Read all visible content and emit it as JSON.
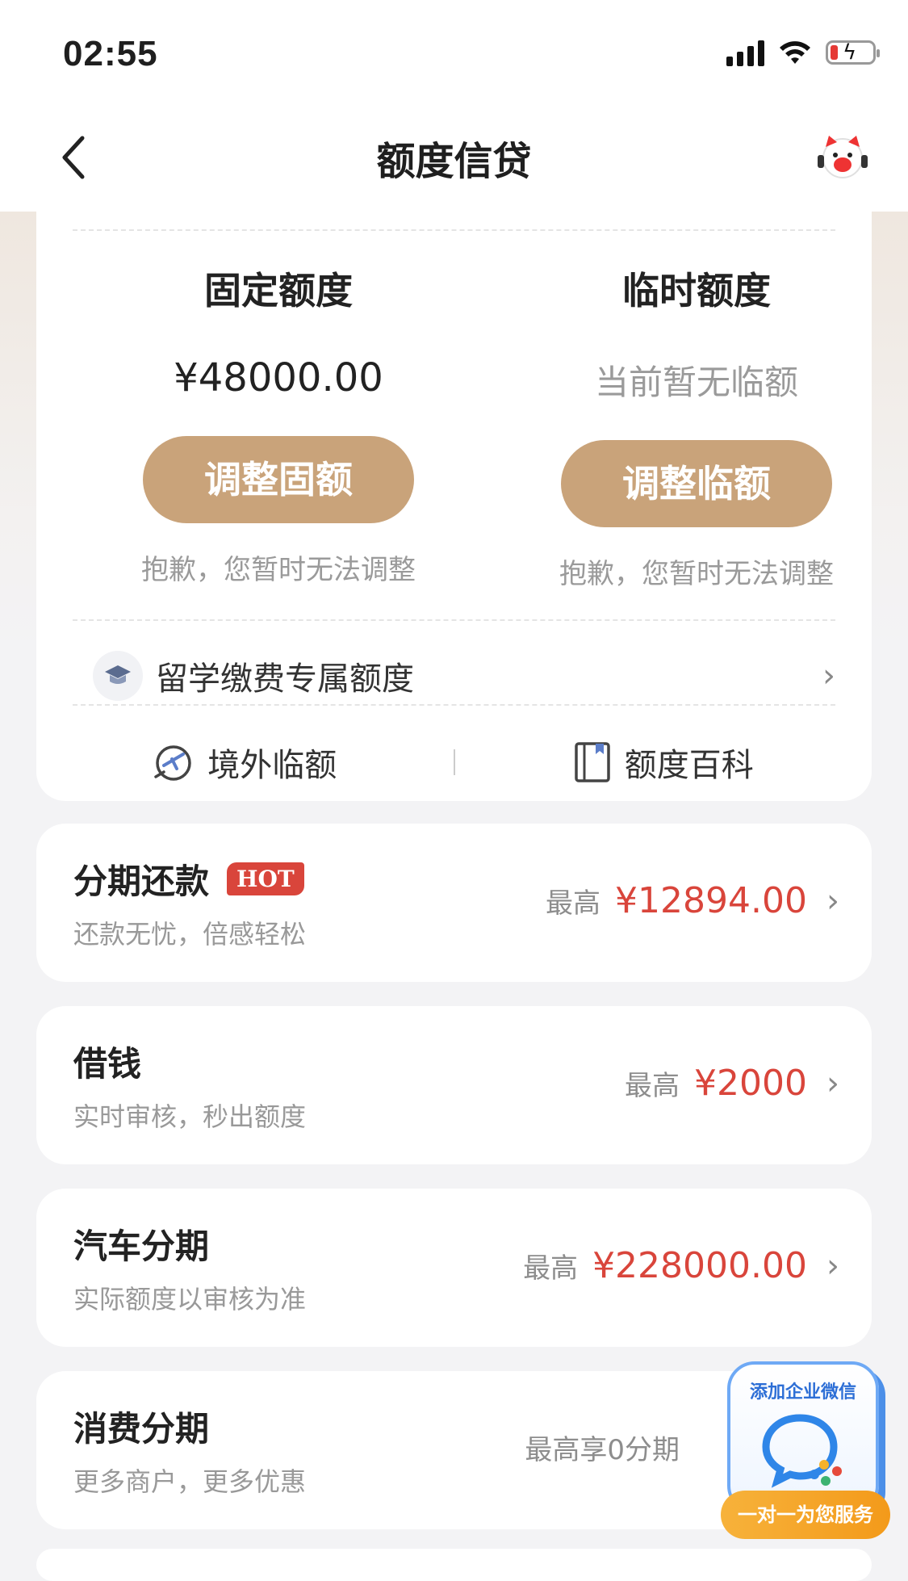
{
  "status": {
    "time": "02:55",
    "battery_percent": 15
  },
  "nav": {
    "title": "额度信贷"
  },
  "limits": {
    "fixed": {
      "title": "固定额度",
      "amount": "¥48000.00",
      "button": "调整固额",
      "hint": "抱歉，您暂时无法调整"
    },
    "temp": {
      "title": "临时额度",
      "amount": "当前暂无临额",
      "button": "调整临额",
      "hint": "抱歉，您暂时无法调整"
    }
  },
  "study": {
    "label": "留学缴费专属额度"
  },
  "footer": {
    "overseas": "境外临额",
    "wiki": "额度百科"
  },
  "items": [
    {
      "title": "分期还款",
      "badge": "HOT",
      "sub": "还款无忧，倍感轻松",
      "max_label": "最高",
      "max_value": "¥12894.00"
    },
    {
      "title": "借钱",
      "sub": "实时审核，秒出额度",
      "max_label": "最高",
      "max_value": "¥2000"
    },
    {
      "title": "汽车分期",
      "sub": "实际额度以审核为准",
      "max_label": "最高",
      "max_value": "¥228000.00"
    },
    {
      "title": "消费分期",
      "sub": "更多商户，更多优惠",
      "max_label": "最高享0分期"
    }
  ],
  "wechat": {
    "title": "添加企业微信",
    "button": "一对一为您服务"
  },
  "colors": {
    "accent": "#c9a37a",
    "red": "#d9453b",
    "wechat_blue": "#2d6fd6"
  }
}
